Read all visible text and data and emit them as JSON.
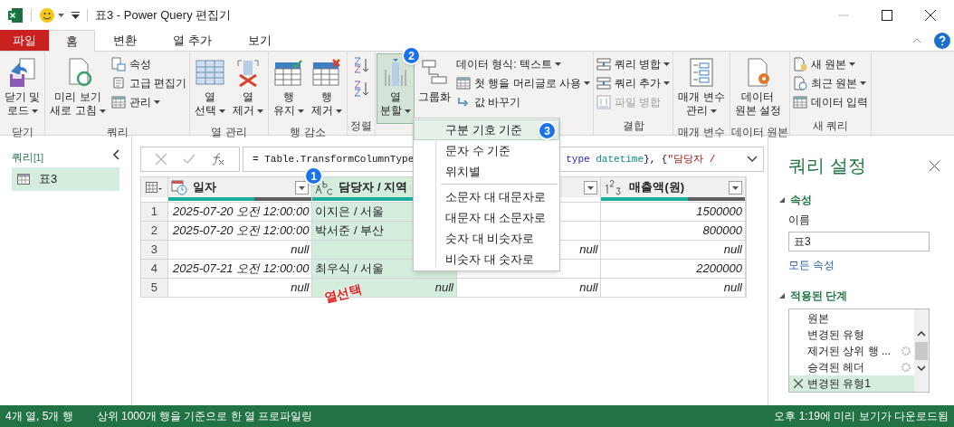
{
  "window": {
    "title": "표3 - Power Query 편집기"
  },
  "ribbon_tabs": [
    {
      "label": "파일",
      "kind": "file",
      "selected": false
    },
    {
      "label": "홈",
      "kind": "tab",
      "selected": true
    },
    {
      "label": "변환",
      "kind": "tab",
      "selected": false
    },
    {
      "label": "열 추가",
      "kind": "tab",
      "selected": false
    },
    {
      "label": "보기",
      "kind": "tab",
      "selected": false
    }
  ],
  "ribbon_groups": [
    {
      "label": "닫기",
      "items": [
        {
          "kind": "large",
          "lines": [
            "닫기 및",
            "로드"
          ],
          "dropdown": true,
          "selected": false
        }
      ]
    },
    {
      "label": "쿼리",
      "items": [
        {
          "kind": "large",
          "lines": [
            "미리 보기",
            "새로 고침"
          ],
          "dropdown": true,
          "selected": false
        },
        {
          "kind": "stack",
          "buttons": [
            {
              "label": "속성",
              "dropdown": false,
              "disabled": false
            },
            {
              "label": "고급 편집기",
              "dropdown": false,
              "disabled": false
            },
            {
              "label": "관리",
              "dropdown": true,
              "disabled": false
            }
          ]
        }
      ]
    },
    {
      "label": "열 관리",
      "items": [
        {
          "kind": "large",
          "lines": [
            "열",
            "선택"
          ],
          "dropdown": true,
          "selected": false
        },
        {
          "kind": "large",
          "lines": [
            "열",
            "제거"
          ],
          "dropdown": true,
          "selected": false
        }
      ]
    },
    {
      "label": "행 감소",
      "items": [
        {
          "kind": "large",
          "lines": [
            "행",
            "유지"
          ],
          "dropdown": true,
          "selected": false
        },
        {
          "kind": "large",
          "lines": [
            "행",
            "제거"
          ],
          "dropdown": true,
          "selected": false
        }
      ]
    },
    {
      "label": "정렬",
      "items": [
        {
          "kind": "sort"
        }
      ]
    },
    {
      "items": [
        {
          "kind": "large",
          "lines": [
            "열",
            "분할"
          ],
          "dropdown": true,
          "selected": true
        },
        {
          "kind": "large",
          "lines": [
            "그룹화"
          ],
          "dropdown": false,
          "selected": false
        },
        {
          "kind": "stack",
          "buttons": [
            {
              "label": "데이터 형식: 텍스트",
              "dropdown": true,
              "disabled": false
            },
            {
              "label": "첫 행을 머리글로 사용",
              "dropdown": true,
              "disabled": false
            },
            {
              "label": "값 바꾸기",
              "dropdown": false,
              "disabled": false
            }
          ]
        }
      ]
    },
    {
      "label": "결합",
      "items": [
        {
          "kind": "stack",
          "buttons": [
            {
              "label": "쿼리 병합",
              "dropdown": true,
              "disabled": false
            },
            {
              "label": "쿼리 추가",
              "dropdown": true,
              "disabled": false
            },
            {
              "label": "파일 병합",
              "dropdown": false,
              "disabled": true
            }
          ]
        }
      ]
    },
    {
      "label": "매개 변수",
      "items": [
        {
          "kind": "large",
          "lines": [
            "매개 변수",
            "관리"
          ],
          "dropdown": true,
          "selected": false
        }
      ]
    },
    {
      "label": "데이터 원본",
      "items": [
        {
          "kind": "large",
          "lines": [
            "데이터",
            "원본 설정"
          ],
          "dropdown": false,
          "selected": false
        }
      ]
    },
    {
      "label": "새 쿼리",
      "items": [
        {
          "kind": "stack",
          "buttons": [
            {
              "label": "새 원본",
              "dropdown": true,
              "disabled": false
            },
            {
              "label": "최근 원본",
              "dropdown": true,
              "disabled": false
            },
            {
              "label": "데이터 입력",
              "dropdown": false,
              "disabled": false
            }
          ]
        }
      ]
    }
  ],
  "queries_pane": {
    "title": "쿼리",
    "count": "[1]",
    "items": [
      {
        "label": "표3",
        "selected": true
      }
    ]
  },
  "formula": {
    "parts": [
      [
        {
          "text": "= Table.TransformColumnType",
          "kind": "plain"
        }
      ],
      [
        {
          "text": "type",
          "kind": "keyword"
        },
        {
          "text": " datetime",
          "kind": "type"
        },
        {
          "text": "}, {",
          "kind": "plain"
        },
        {
          "text": "\"담당자 /",
          "kind": "string"
        }
      ]
    ]
  },
  "table": {
    "columns": [
      {
        "kind": "datetime",
        "title": "일자",
        "level": 0.6,
        "selected": false
      },
      {
        "kind": "text",
        "title": "담당자 / 지역",
        "level": 0.87,
        "selected": true
      },
      {
        "kind": "any",
        "selected": false
      },
      {
        "kind": "number",
        "title": "매출액(원)",
        "level": 0.6,
        "selected": false
      }
    ],
    "rows": [
      {
        "number": "1",
        "cells": [
          "2025-07-20 오전 12:00:00",
          "이지은 / 서울",
          null,
          "1500000"
        ]
      },
      {
        "number": "2",
        "cells": [
          "2025-07-20 오전 12:00:00",
          "박서준 / 부산",
          null,
          "800000"
        ]
      },
      {
        "number": "3",
        "cells": [
          "null",
          null,
          "null",
          "null"
        ]
      },
      {
        "number": "4",
        "cells": [
          "2025-07-21 오전 12:00:00",
          "최우식 / 서울",
          null,
          "2200000"
        ]
      },
      {
        "number": "5",
        "cells": [
          "null",
          "null",
          "null",
          "null"
        ]
      }
    ]
  },
  "split_menu": {
    "sections": [
      [
        {
          "label": "구분 기호 기준",
          "selected": true
        },
        {
          "label": "문자 수 기준",
          "selected": false
        },
        {
          "label": "위치별",
          "selected": false
        }
      ],
      [
        {
          "label": "소문자 대 대문자로",
          "selected": false
        },
        {
          "label": "대문자 대 소문자로",
          "selected": false
        },
        {
          "label": "숫자 대 비숫자로",
          "selected": false
        },
        {
          "label": "비숫자 대 숫자로",
          "selected": false
        }
      ]
    ]
  },
  "settings_pane": {
    "title": "쿼리 설정",
    "properties": {
      "heading": "속성",
      "name_label": "이름",
      "name_value": "표3",
      "all_properties": "모든 속성"
    },
    "steps": {
      "heading": "적용된 단계",
      "items": [
        {
          "label": "원본",
          "settings": false,
          "selected": false
        },
        {
          "label": "변경된 유형",
          "settings": false,
          "selected": false
        },
        {
          "label": "제거된 상위 행 ...",
          "settings": true,
          "selected": false
        },
        {
          "label": "승격된 헤더",
          "settings": true,
          "selected": false
        },
        {
          "label": "변경된 유형1",
          "settings": false,
          "selected": true
        }
      ]
    }
  },
  "status_bar": {
    "left": [
      "4개 열, 5개 행",
      "상위 1000개 행을 기준으로 한 열 프로파일링"
    ],
    "right": "오후 1:19에 미리 보기가 다운로드됨"
  },
  "annotations": {
    "badges": [
      "1",
      "2",
      "3"
    ],
    "callout": "열선택"
  }
}
